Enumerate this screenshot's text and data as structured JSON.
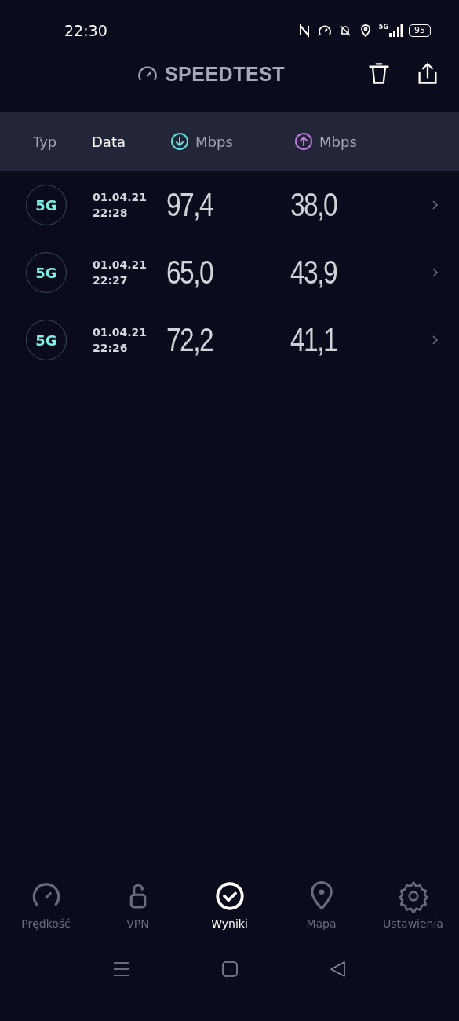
{
  "status_bar": {
    "time": "22:30",
    "network": "5G",
    "battery": "95"
  },
  "app_bar": {
    "title": "SPEEDTEST"
  },
  "columns": [
    {
      "kind": "text",
      "label": "Typ",
      "selected": false
    },
    {
      "kind": "text",
      "label": "Data",
      "selected": true
    },
    {
      "kind": "download",
      "label": "Mbps",
      "selected": false
    },
    {
      "kind": "upload",
      "label": "Mbps",
      "selected": false
    }
  ],
  "results": [
    {
      "type": "5G",
      "date": "01.04.21",
      "time": "22:28",
      "download": "97,4",
      "upload": "38,0"
    },
    {
      "type": "5G",
      "date": "01.04.21",
      "time": "22:27",
      "download": "65,0",
      "upload": "43,9"
    },
    {
      "type": "5G",
      "date": "01.04.21",
      "time": "22:26",
      "download": "72,2",
      "upload": "41,1"
    }
  ],
  "tabs": [
    {
      "kind": "speed",
      "label": "Prędkość",
      "selected": false
    },
    {
      "kind": "vpn",
      "label": "VPN",
      "selected": false
    },
    {
      "kind": "results",
      "label": "Wyniki",
      "selected": true
    },
    {
      "kind": "map",
      "label": "Mapa",
      "selected": false
    },
    {
      "kind": "settings",
      "label": "Ustawienia",
      "selected": false
    }
  ]
}
